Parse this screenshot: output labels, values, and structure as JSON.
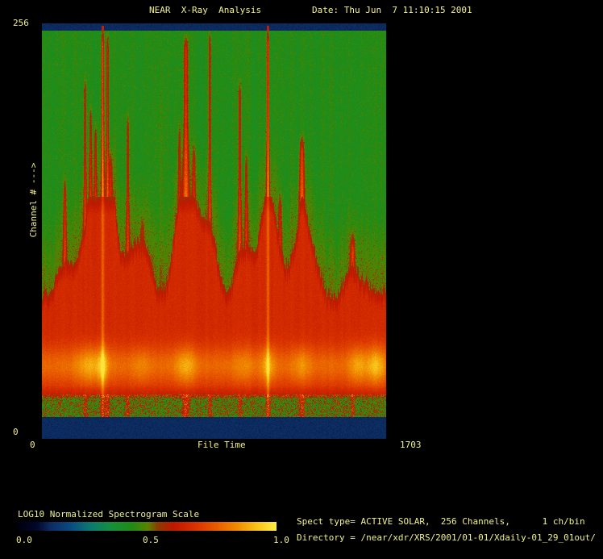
{
  "header": {
    "title": "NEAR  X-Ray  Analysis",
    "date_label": "Date: Thu Jun  7 11:10:15 2001"
  },
  "axes": {
    "y_max": "256",
    "y_min": "0",
    "y_label": "Channel # --->",
    "x_min": "0",
    "x_label": "File Time",
    "x_max": "1703"
  },
  "colorbar": {
    "label": "LOG10 Normalized Spectrogram Scale",
    "tick_low": "0.0",
    "tick_mid": "0.5",
    "tick_high": "1.0"
  },
  "info": {
    "spect_line": "Spect type= ACTIVE SOLAR,  256 Channels,      1 ch/bin",
    "directory_line": "Directory = /near/xdr/XRS/2001/01-01/Xdaily-01_29_01out/"
  },
  "colors": {
    "background": "#000000",
    "text": "#f1f18e",
    "frame_band": "#0d2d62",
    "field_green": "#208c14",
    "band_red": "#d83000",
    "core_yellow": "#ffee44"
  },
  "chart_data": {
    "type": "heatmap",
    "title": "NEAR X-Ray Analysis",
    "date": "Thu Jun  7 11:10:15 2001",
    "xlabel": "File Time",
    "xlim": [
      0,
      1703
    ],
    "ylabel": "Channel #",
    "ylim": [
      0,
      256
    ],
    "legend_position": "bottom-left colorbar",
    "grid": false,
    "colorbar": {
      "label": "LOG10 Normalized Spectrogram Scale",
      "ticks": [
        0.0,
        0.5,
        1.0
      ],
      "stops": [
        {
          "pos": 0.0,
          "color": "#000010"
        },
        {
          "pos": 0.07,
          "color": "#02082a"
        },
        {
          "pos": 0.125,
          "color": "#0d2d62"
        },
        {
          "pos": 0.2,
          "color": "#0a4a80"
        },
        {
          "pos": 0.28,
          "color": "#0c7a70"
        },
        {
          "pos": 0.36,
          "color": "#15903c"
        },
        {
          "pos": 0.44,
          "color": "#208c14"
        },
        {
          "pos": 0.5,
          "color": "#5a8400"
        },
        {
          "pos": 0.54,
          "color": "#8c3c00"
        },
        {
          "pos": 0.6,
          "color": "#c01800"
        },
        {
          "pos": 0.68,
          "color": "#d83000"
        },
        {
          "pos": 0.76,
          "color": "#e85800"
        },
        {
          "pos": 0.84,
          "color": "#f08800"
        },
        {
          "pos": 0.92,
          "color": "#f8c018"
        },
        {
          "pos": 1.0,
          "color": "#ffee44"
        }
      ]
    },
    "background_level": 0.435,
    "bands": [
      {
        "name": "top-frame",
        "channels": [
          252,
          256
        ],
        "level": 0.125
      },
      {
        "name": "quiet-continuum",
        "channels": [
          92,
          252
        ],
        "level": 0.435
      },
      {
        "name": "solar-continuum",
        "channels": [
          28,
          92
        ],
        "level": 0.7,
        "core_peak_channel": 45,
        "core_peak_level": 0.95
      },
      {
        "name": "low-channel-speckle",
        "channels": [
          14,
          28
        ],
        "level": 0.47
      },
      {
        "name": "bottom-frame",
        "channels": [
          0,
          14
        ],
        "level": 0.125
      }
    ],
    "continuum_top_channel": 92,
    "flares": [
      {
        "file_time": 112,
        "intensity": 0.5,
        "width": 5,
        "top_channel": 165,
        "spread": 2
      },
      {
        "file_time": 211,
        "intensity": 0.55,
        "width": 8,
        "top_channel": 227,
        "spread": 2.5
      },
      {
        "file_time": 239,
        "intensity": 0.5,
        "width": 9,
        "top_channel": 210,
        "spread": 2.5
      },
      {
        "file_time": 263,
        "intensity": 0.5,
        "width": 6,
        "top_channel": 200,
        "spread": 2
      },
      {
        "file_time": 299,
        "intensity": 1.0,
        "width": 6,
        "top_channel": 256,
        "spread": 1.5
      },
      {
        "file_time": 323,
        "intensity": 0.72,
        "width": 7,
        "top_channel": 253,
        "spread": 2
      },
      {
        "file_time": 339,
        "intensity": 0.48,
        "width": 6,
        "top_channel": 180,
        "spread": 2
      },
      {
        "file_time": 423,
        "intensity": 0.55,
        "width": 6,
        "top_channel": 205,
        "spread": 2
      },
      {
        "file_time": 494,
        "intensity": 0.32,
        "width": 6,
        "top_channel": 140,
        "spread": 2
      },
      {
        "file_time": 534,
        "intensity": 0.42,
        "width": 6,
        "top_channel": 115,
        "spread": 2.5
      },
      {
        "file_time": 678,
        "intensity": 0.4,
        "width": 6,
        "top_channel": 200,
        "spread": 2
      },
      {
        "file_time": 710,
        "intensity": 0.8,
        "width": 16,
        "top_channel": 252,
        "spread": 5
      },
      {
        "file_time": 750,
        "intensity": 0.45,
        "width": 8,
        "top_channel": 185,
        "spread": 3
      },
      {
        "file_time": 829,
        "intensity": 0.65,
        "width": 6,
        "top_channel": 256,
        "spread": 1.5
      },
      {
        "file_time": 977,
        "intensity": 0.58,
        "width": 9,
        "top_channel": 225,
        "spread": 2.5
      },
      {
        "file_time": 1009,
        "intensity": 0.45,
        "width": 5,
        "top_channel": 180,
        "spread": 2
      },
      {
        "file_time": 1117,
        "intensity": 1.0,
        "width": 6,
        "top_channel": 256,
        "spread": 1.5
      },
      {
        "file_time": 1176,
        "intensity": 0.4,
        "width": 5,
        "top_channel": 155,
        "spread": 2
      },
      {
        "file_time": 1284,
        "intensity": 0.7,
        "width": 13,
        "top_channel": 190,
        "spread": 4
      },
      {
        "file_time": 1535,
        "intensity": 0.55,
        "width": 7,
        "top_channel": 130,
        "spread": 3
      },
      {
        "file_time": 1615,
        "intensity": 0.35,
        "width": 8,
        "top_channel": 75,
        "spread": 3
      }
    ],
    "halos": [
      {
        "file_time": 590,
        "width": 35,
        "intensity": 0.1,
        "top_channel": 235
      },
      {
        "file_time": 710,
        "width": 52,
        "intensity": 0.3,
        "top_channel": 150
      },
      {
        "file_time": 1284,
        "width": 36,
        "intensity": 0.25,
        "top_channel": 120
      }
    ],
    "core_brightness": [
      {
        "file_time": 240,
        "intensity": 0.45,
        "width": 100
      },
      {
        "file_time": 300,
        "intensity": 0.5,
        "width": 36
      },
      {
        "file_time": 490,
        "intensity": 0.2,
        "width": 60
      },
      {
        "file_time": 710,
        "intensity": 0.45,
        "width": 72
      },
      {
        "file_time": 1000,
        "intensity": 0.2,
        "width": 80
      },
      {
        "file_time": 1117,
        "intensity": 0.5,
        "width": 44
      },
      {
        "file_time": 1284,
        "intensity": 0.3,
        "width": 60
      },
      {
        "file_time": 1560,
        "intensity": 0.4,
        "width": 60
      },
      {
        "file_time": 1650,
        "intensity": 0.55,
        "width": 64
      }
    ]
  }
}
